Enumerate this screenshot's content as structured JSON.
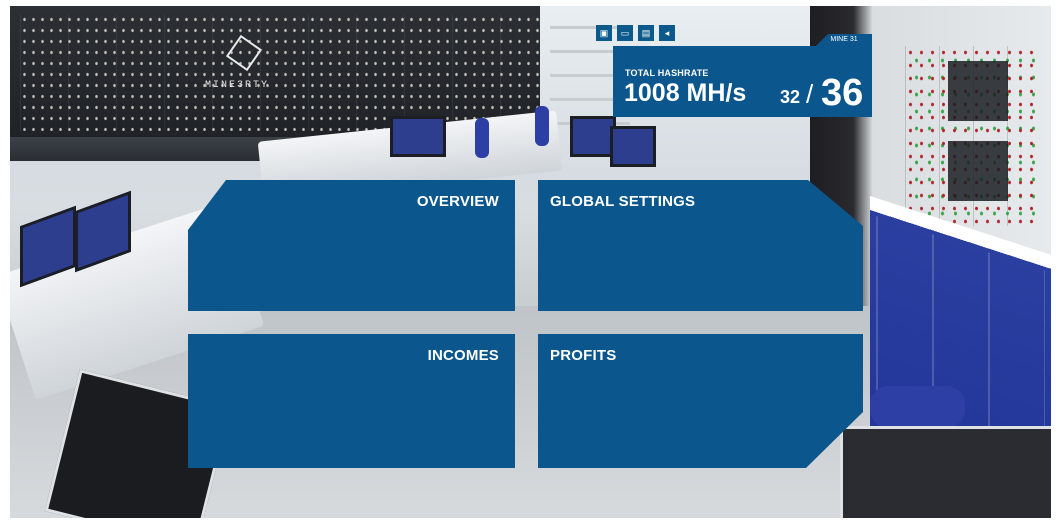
{
  "logo": {
    "text": "MINE3RTY"
  },
  "toolbar": {
    "buttons": [
      {
        "icon": "save-icon",
        "glyph": "▣"
      },
      {
        "icon": "device-icon",
        "glyph": "▭"
      },
      {
        "icon": "trash-icon",
        "glyph": "▤"
      },
      {
        "icon": "sound-icon",
        "glyph": "◂"
      }
    ]
  },
  "hashrate": {
    "mine_label": "MINE 31",
    "label": "TOTAL HASHRATE",
    "value": "1008 MH/s",
    "active_count": "32",
    "separator": "/",
    "total_count": "36"
  },
  "menu": {
    "overview": "OVERVIEW",
    "global_settings": "GLOBAL SETTINGS",
    "incomes": "INCOMES",
    "profits": "PROFITS"
  },
  "colors": {
    "panel": "#0b578d",
    "text": "#ffffff"
  }
}
